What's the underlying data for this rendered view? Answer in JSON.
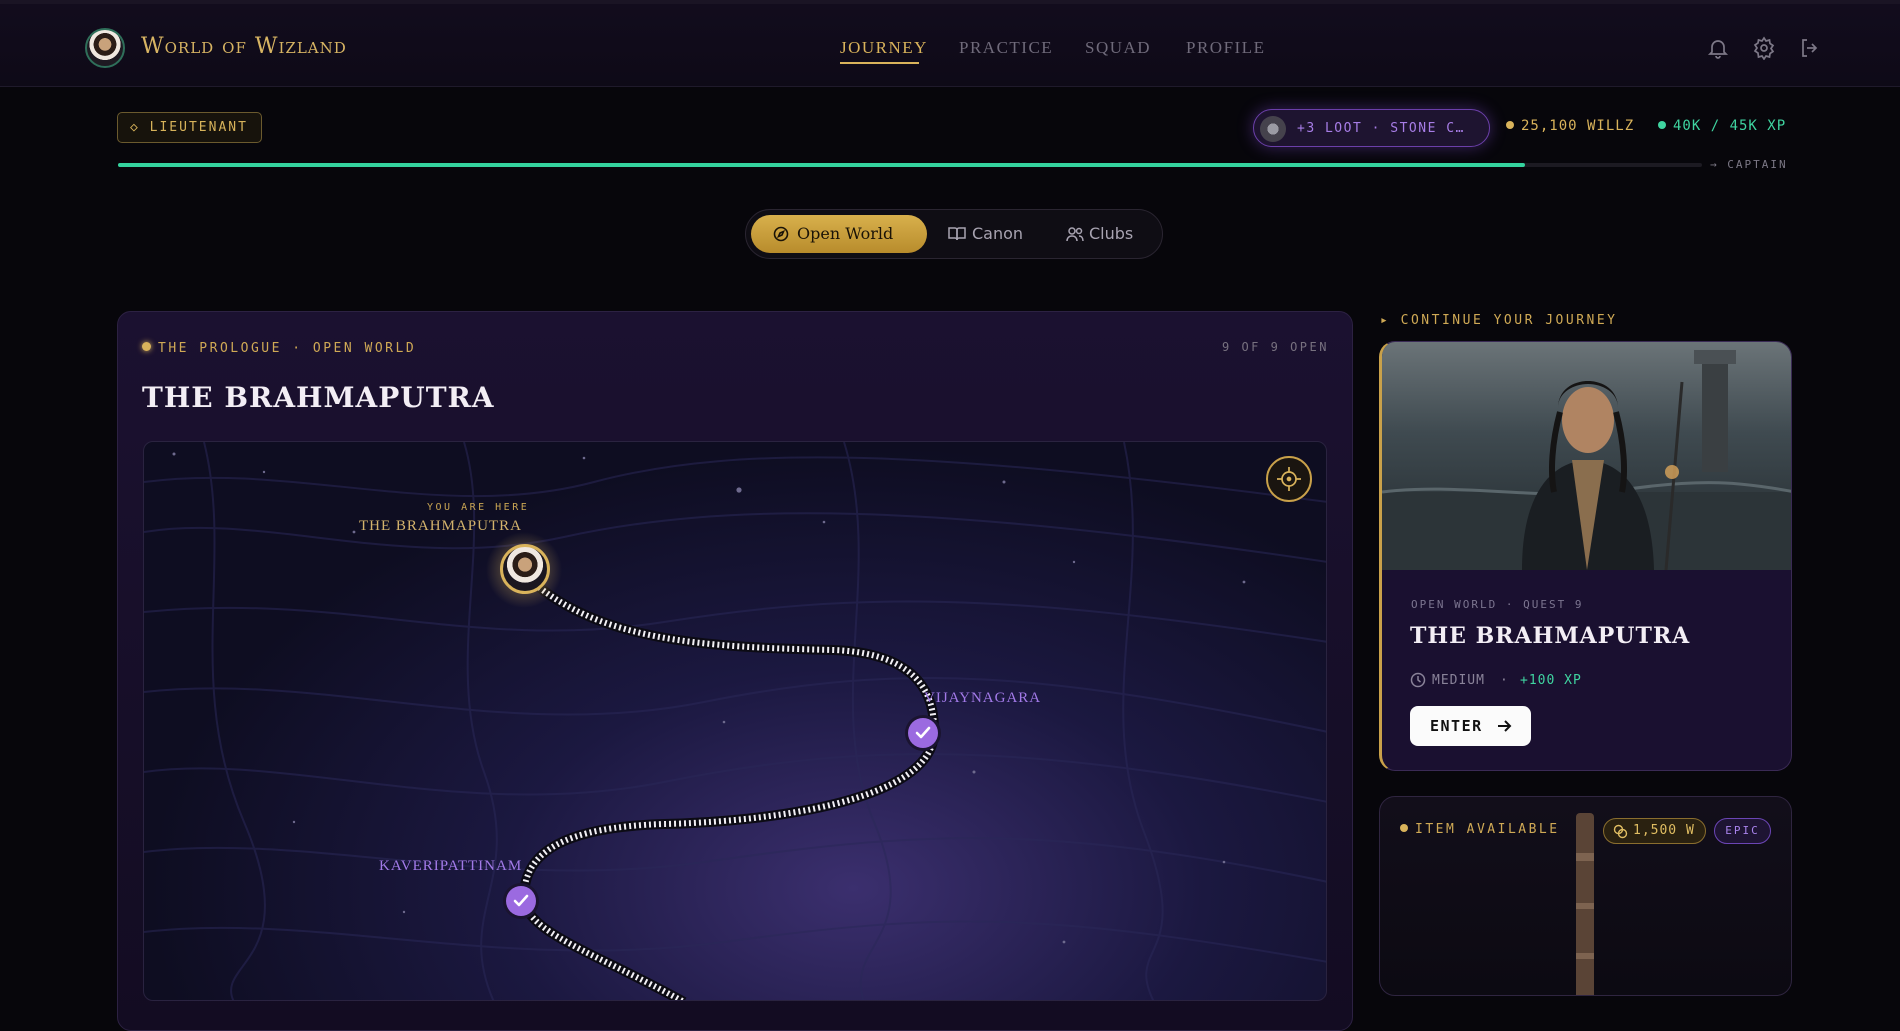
{
  "app": {
    "title": "World of Wizland"
  },
  "nav": {
    "items": [
      "JOURNEY",
      "PRACTICE",
      "SQUAD",
      "PROFILE"
    ],
    "active": "JOURNEY"
  },
  "header_icons": [
    "bell-icon",
    "gear-icon",
    "logout-icon"
  ],
  "player": {
    "rank": "◇ LIEUTENANT",
    "loot": "+3 LOOT · STONE C…",
    "willz": "25,100 WILLZ",
    "xp": "40K / 45K XP",
    "xp_progress": 0.888,
    "next_rank": "→ CAPTAIN"
  },
  "modes": {
    "items": [
      "Open World",
      "Canon",
      "Clubs"
    ],
    "active": "Open World"
  },
  "map_panel": {
    "eyebrow": "THE PROLOGUE · OPEN WORLD",
    "count": "9 OF 9 OPEN",
    "title": "THE BRAHMAPUTRA",
    "you_are_here": "YOU ARE HERE",
    "current_location": "THE BRAHMAPUTRA",
    "nodes": [
      {
        "name": "VIJAYNAGARA",
        "status": "completed"
      },
      {
        "name": "KAVERIPATTINAM",
        "status": "completed"
      }
    ]
  },
  "continue": {
    "eyebrow": "▸ CONTINUE YOUR JOURNEY",
    "meta": "OPEN WORLD · QUEST 9",
    "title": "THE BRAHMAPUTRA",
    "difficulty": "MEDIUM",
    "separator": "·",
    "reward": "+100 XP",
    "cta": "ENTER"
  },
  "item": {
    "label": "ITEM AVAILABLE",
    "price": "1,500 W",
    "rarity": "EPIC"
  },
  "colors": {
    "gold": "#d9b35b",
    "xp_green": "#34d39e",
    "purple": "#9b6ae0",
    "background": "#07060b"
  }
}
